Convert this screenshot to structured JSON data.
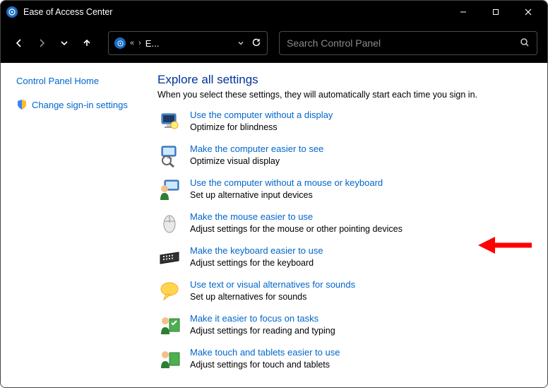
{
  "window": {
    "title": "Ease of Access Center"
  },
  "address": {
    "crumb": "E..."
  },
  "search": {
    "placeholder": "Search Control Panel"
  },
  "sidebar": {
    "home": "Control Panel Home",
    "signin": "Change sign-in settings"
  },
  "main": {
    "heading": "Explore all settings",
    "sub": "When you select these settings, they will automatically start each time you sign in.",
    "items": [
      {
        "title": "Use the computer without a display",
        "desc": "Optimize for blindness"
      },
      {
        "title": "Make the computer easier to see",
        "desc": "Optimize visual display"
      },
      {
        "title": "Use the computer without a mouse or keyboard",
        "desc": "Set up alternative input devices"
      },
      {
        "title": "Make the mouse easier to use",
        "desc": "Adjust settings for the mouse or other pointing devices"
      },
      {
        "title": "Make the keyboard easier to use",
        "desc": "Adjust settings for the keyboard"
      },
      {
        "title": "Use text or visual alternatives for sounds",
        "desc": "Set up alternatives for sounds"
      },
      {
        "title": "Make it easier to focus on tasks",
        "desc": "Adjust settings for reading and typing"
      },
      {
        "title": "Make touch and tablets easier to use",
        "desc": "Adjust settings for touch and tablets"
      }
    ]
  }
}
